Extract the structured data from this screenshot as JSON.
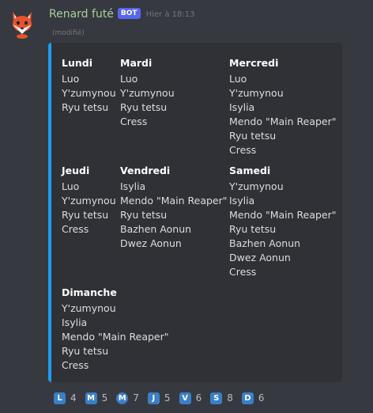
{
  "message": {
    "username": "Renard futé",
    "badge": "BOT",
    "timestamp": "Hier à 18:13",
    "edited_label": "(modifié)",
    "avatar_icon": "fox-icon"
  },
  "colors": {
    "background": "#36393f",
    "embed_bg": "#2f3136",
    "embed_border": "#1f9cf0",
    "username": "#a8d0a0",
    "badge": "#5865f2",
    "reaction_emoji": "#3a7fc7"
  },
  "embed": {
    "fields": [
      {
        "name": "Lundi",
        "values": [
          "Luo",
          "Y'zumynou",
          "Ryu tetsu"
        ]
      },
      {
        "name": "Mardi",
        "values": [
          "Luo",
          "Y'zumynou",
          "Ryu tetsu",
          "Cress"
        ]
      },
      {
        "name": "Mercredi",
        "values": [
          "Luo",
          "Y'zumynou",
          "Isylia",
          "Mendo \"Main Reaper\"",
          "Ryu tetsu",
          "Cress"
        ]
      },
      {
        "name": "Jeudi",
        "values": [
          "Luo",
          "Y'zumynou",
          "Ryu tetsu",
          "Cress"
        ]
      },
      {
        "name": "Vendredi",
        "values": [
          "Isylia",
          "Mendo \"Main Reaper\"",
          "Ryu tetsu",
          "Bazhen Aonun",
          "Dwez Aonun"
        ]
      },
      {
        "name": "Samedi",
        "values": [
          "Y'zumynou",
          "Isylia",
          "Mendo \"Main Reaper\"",
          "Ryu tetsu",
          "Bazhen Aonun",
          "Dwez Aonun",
          "Cress"
        ]
      },
      {
        "name": "Dimanche",
        "values": [
          "Y'zumynou",
          "Isylia",
          "Mendo \"Main Reaper\"",
          "Ryu tetsu",
          "Cress"
        ]
      }
    ]
  },
  "reactions": [
    {
      "emoji": "L",
      "count": "4",
      "icon": "regional-indicator-l-icon"
    },
    {
      "emoji": "M",
      "count": "5",
      "icon": "regional-indicator-m-icon"
    },
    {
      "emoji": "M",
      "count": "7",
      "icon": "circled-m-icon",
      "round": true
    },
    {
      "emoji": "J",
      "count": "5",
      "icon": "regional-indicator-j-icon"
    },
    {
      "emoji": "V",
      "count": "6",
      "icon": "regional-indicator-v-icon"
    },
    {
      "emoji": "S",
      "count": "8",
      "icon": "regional-indicator-s-icon"
    },
    {
      "emoji": "D",
      "count": "6",
      "icon": "regional-indicator-d-icon"
    }
  ]
}
